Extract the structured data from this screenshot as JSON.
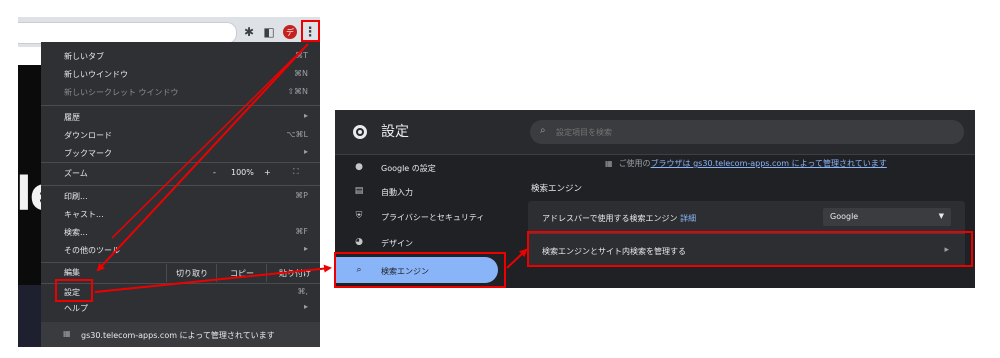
{
  "browser": {
    "profile_initial": "デ"
  },
  "chrome_menu": {
    "new_tab": {
      "label": "新しいタブ",
      "shortcut": "⌘T"
    },
    "new_window": {
      "label": "新しいウインドウ",
      "shortcut": "⌘N"
    },
    "new_incognito": {
      "label": "新しいシークレット ウインドウ",
      "shortcut": "⇧⌘N"
    },
    "history": {
      "label": "履歴"
    },
    "downloads": {
      "label": "ダウンロード",
      "shortcut": "⌥⌘L"
    },
    "bookmarks": {
      "label": "ブックマーク"
    },
    "zoom": {
      "label": "ズーム",
      "minus": "-",
      "level": "100%",
      "plus": "+"
    },
    "print": {
      "label": "印刷...",
      "shortcut": "⌘P"
    },
    "cast": {
      "label": "キャスト..."
    },
    "find": {
      "label": "検索...",
      "shortcut": "⌘F"
    },
    "more_tools": {
      "label": "その他のツール"
    },
    "edit": {
      "label": "編集",
      "cut": "切り取り",
      "copy": "コピー",
      "paste": "貼り付け"
    },
    "settings": {
      "label": "設定",
      "shortcut": "⌘,"
    },
    "help": {
      "label": "ヘルプ"
    },
    "managed_by": "gs30.telecom-apps.com によって管理されています"
  },
  "settings": {
    "title": "設定",
    "search_placeholder": "設定項目を検索",
    "nav": [
      {
        "label": "Google の設定",
        "icon": "person-icon"
      },
      {
        "label": "自動入力",
        "icon": "clipboard-icon"
      },
      {
        "label": "プライバシーとセキュリティ",
        "icon": "shield-icon"
      },
      {
        "label": "デザイン",
        "icon": "palette-icon"
      },
      {
        "label": "検索エンジン",
        "icon": "search-icon"
      }
    ],
    "managed_notice_prefix": "ご使用の",
    "managed_notice_link": "ブラウザは gs30.telecom-apps.com によって管理されています",
    "section_title": "検索エンジン",
    "address_bar_label": "アドレスバーで使用する検索エンジン",
    "address_bar_link": "詳細",
    "engine_selected": "Google",
    "manage_label": "検索エンジンとサイト内検索を管理する"
  },
  "colors": {
    "annotation_red": "#ee0000",
    "nav_active": "#8ab4f8",
    "link_blue": "#8ab4f8"
  }
}
